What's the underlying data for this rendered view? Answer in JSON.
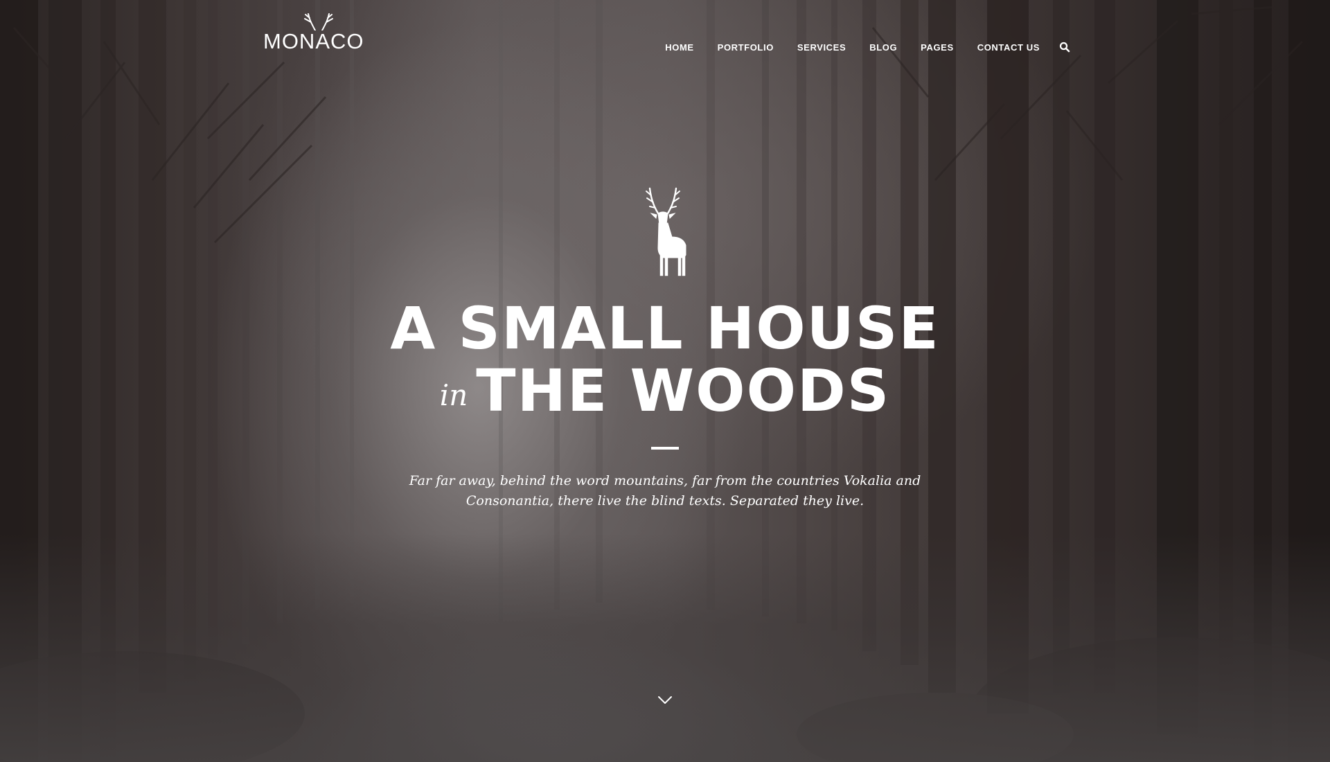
{
  "brand": {
    "logo_text": "MONACO",
    "logo_icon": "antlers-icon"
  },
  "nav": {
    "items": [
      {
        "label": "HOME"
      },
      {
        "label": "PORTFOLIO"
      },
      {
        "label": "SERVICES"
      },
      {
        "label": "BLOG"
      },
      {
        "label": "PAGES"
      },
      {
        "label": "CONTACT US"
      }
    ],
    "search_icon": "search-icon"
  },
  "hero": {
    "emblem_icon": "deer-icon",
    "headline_line1": "A SMALL HOUSE",
    "headline_in": "in",
    "headline_line2": "THE WOODS",
    "tagline_line1": "Far far away, behind the word mountains, far from the countries Vokalia and",
    "tagline_line2": "Consonantia, there live the blind texts. Separated they live.",
    "scroll_icon": "chevron-down-icon"
  },
  "colors": {
    "text": "#ffffff",
    "background_dark": "#2a2626",
    "fog": "#8f8a8a"
  }
}
